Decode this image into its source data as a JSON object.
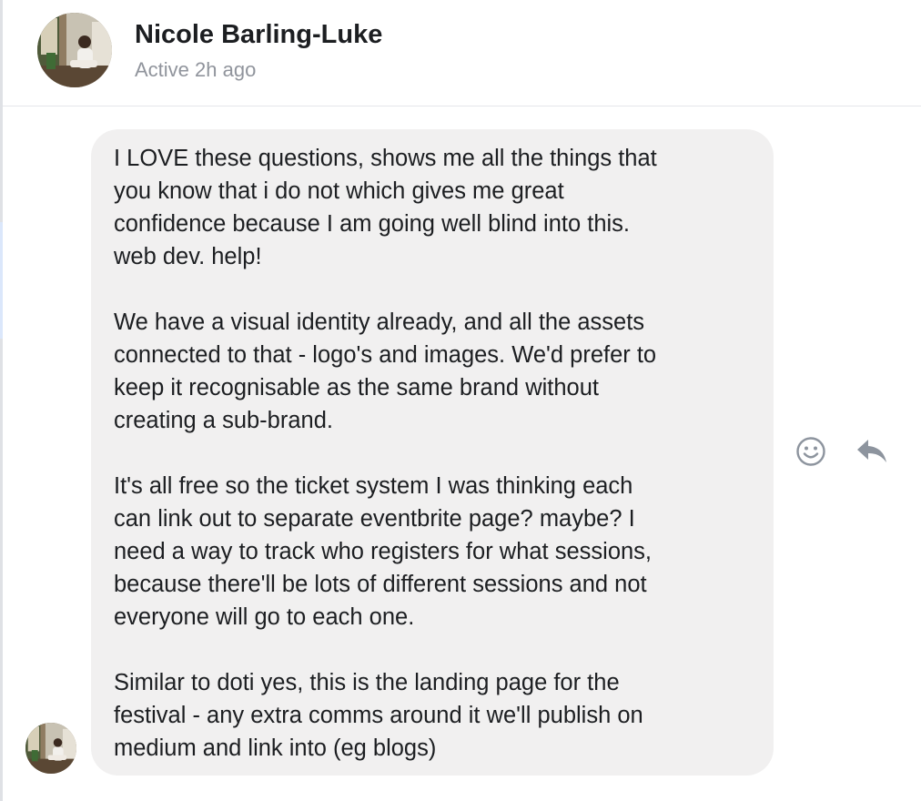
{
  "header": {
    "name": "Nicole Barling-Luke",
    "status": "Active 2h ago",
    "avatar_icon": "profile-photo"
  },
  "message": {
    "paragraphs": [
      "I LOVE these questions, shows me all the things that\nyou know that i do not which gives me great\nconfidence because I am going well blind into this.\nweb dev. help!",
      "We have a visual identity already, and all the assets\nconnected to that - logo's and images. We'd prefer to\nkeep it recognisable as the same brand without\ncreating a sub-brand.",
      "It's all free so the ticket system I was thinking each\ncan link out to separate eventbrite page? maybe? I\nneed a way to track who registers for what sessions,\nbecause there'll be lots of different sessions and not\neveryone will go to each one.",
      "Similar to doti yes, this is the landing page for the\nfestival - any extra comms around it we'll publish on\nmedium and link into (eg blogs)"
    ],
    "bubble_color": "#f1f0f0"
  },
  "actions": {
    "react_icon": "smiley-icon",
    "reply_icon": "reply-arrow-icon",
    "icon_color": "#8d949e"
  },
  "colors": {
    "name_text": "#1c1e21",
    "status_text": "#90949c"
  }
}
